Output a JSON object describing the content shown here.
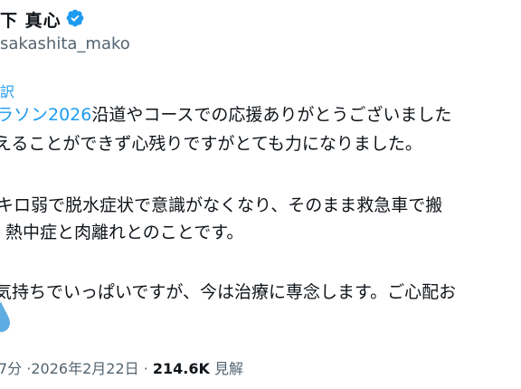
{
  "author": {
    "name": "下 真心",
    "handle": "sakashita_mako",
    "verified_icon": "verified-badge-icon",
    "verified_color": "#1d9bf0"
  },
  "tweet": {
    "translate_label": "訳",
    "line1_hashtag": "ラソン2026",
    "line1_rest": "沿道やコースでの応援ありがとうございました",
    "line2": "えることができず心残りですがとても力になりました。",
    "line3": "キロ弱で脱水症状で意識がなくなり、そのまま救急車で搬",
    "line4": "熱中症と肉離れとのことです。",
    "line5": "気持ちでいっぱいですが、今は治療に専念します。ご心配お",
    "emoji_icon": "droplet-emoji-icon"
  },
  "meta": {
    "time": "7分",
    "date": "·2026年2月22日 ·",
    "views": "214.6K",
    "views_label": "見解"
  },
  "colors": {
    "link": "#1d9bf0",
    "muted": "#536471",
    "text": "#0f1419"
  }
}
